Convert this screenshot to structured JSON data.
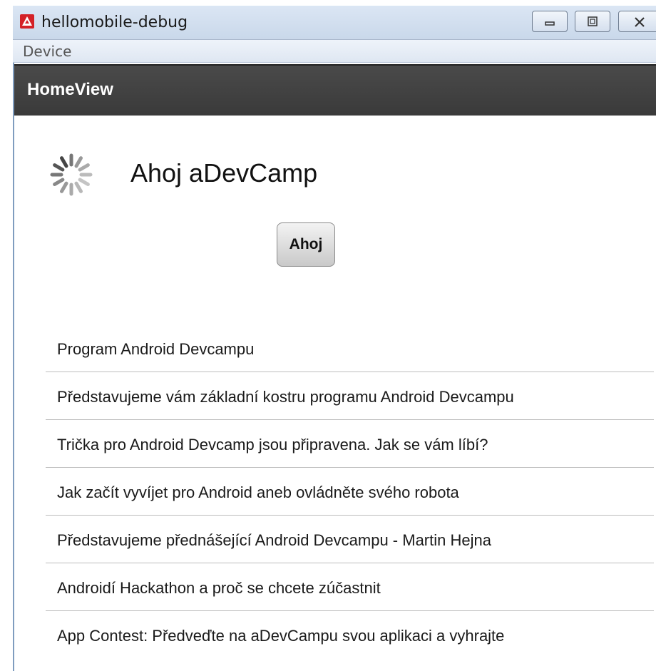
{
  "window": {
    "title": "hellomobile-debug",
    "menu": [
      "Device"
    ]
  },
  "header": {
    "title": "HomeView"
  },
  "main": {
    "greeting": "Ahoj aDevCamp",
    "button_label": "Ahoj",
    "spinner_icon": "loading-spinner-icon",
    "list": [
      "Program Android Devcampu",
      "Představujeme vám základní kostru programu Android Devcampu",
      "Trička pro Android Devcamp jsou připravena. Jak se vám líbí?",
      "Jak začít vyvíjet pro Android aneb ovládněte svého robota",
      "Představujeme přednášející Android Devcampu - Martin Hejna",
      "Androidí Hackathon a proč se chcete zúčastnit",
      "App Contest: Předveďte na aDevCampu svou aplikaci a vyhrajte"
    ]
  },
  "colors": {
    "action_bar": "#3a3a3a",
    "app_icon": "#d42127"
  }
}
